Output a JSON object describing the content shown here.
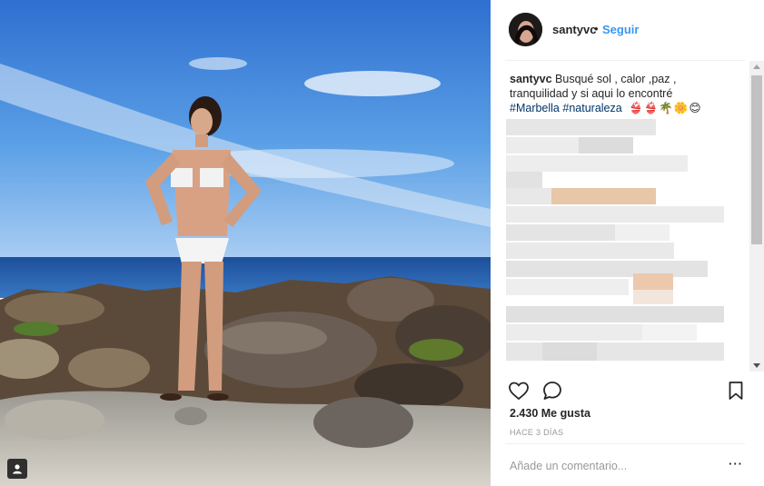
{
  "post": {
    "username": "santyvc",
    "separator": "•",
    "follow_label": "Seguir"
  },
  "caption": {
    "username": "santyvc",
    "text": "Busqué sol , calor ,paz , tranquilidad y si aqui lo encontré",
    "hashtags": [
      "#Marbella",
      "#naturaleza"
    ],
    "emojis": "👙👙🌴🌼😊"
  },
  "actions": {
    "like_icon": "heart-icon",
    "comment_icon": "comment-bubble-icon",
    "save_icon": "bookmark-icon"
  },
  "likes_text": "2.430 Me gusta",
  "time_text": "HACE 3 DÍAS",
  "comment_box": {
    "placeholder": "Añade un comentario..."
  },
  "more_label": "···",
  "colors": {
    "link_blue": "#3897f0",
    "hashtag_blue": "#003569",
    "text_dark": "#262626",
    "muted": "#999999"
  }
}
